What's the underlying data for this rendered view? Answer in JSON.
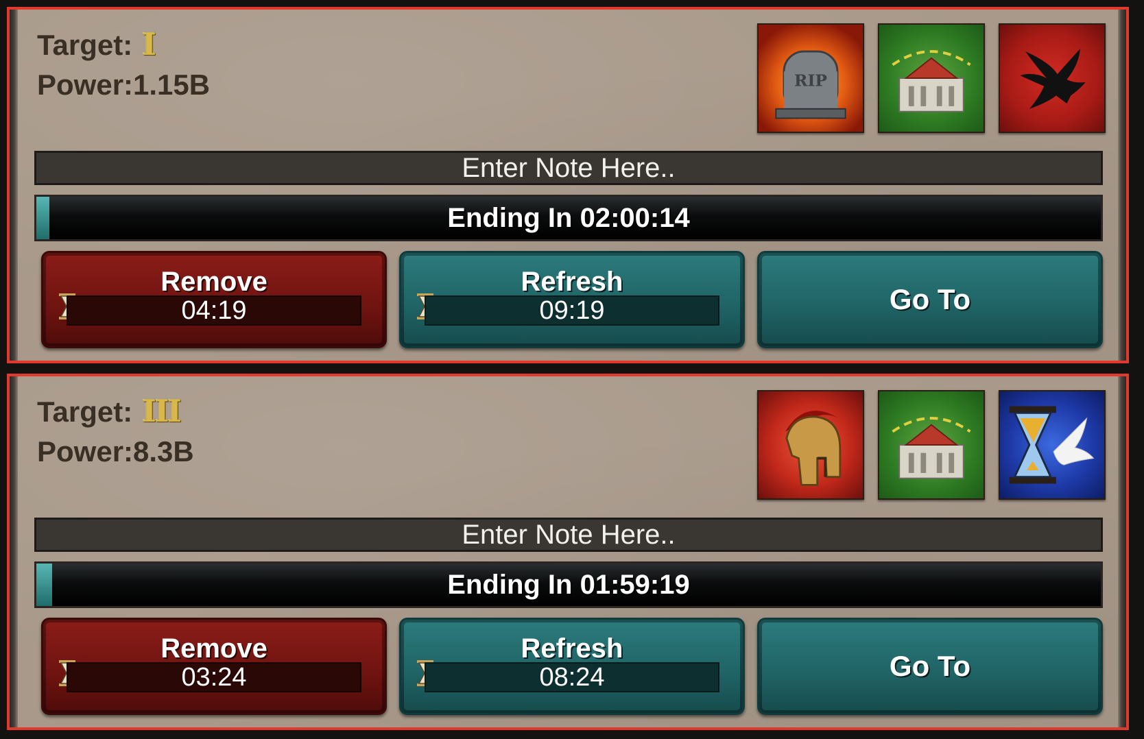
{
  "entries": [
    {
      "target_label": "Target:",
      "rank": "I",
      "power_label": "Power:1.15B",
      "icons": [
        "rip-tombstone-icon",
        "castle-icon",
        "eagle-icon"
      ],
      "note_placeholder": "Enter Note Here..",
      "ending_text": "Ending In 02:00:14",
      "progress": 0.01,
      "remove_label": "Remove",
      "remove_timer": "04:19",
      "refresh_label": "Refresh",
      "refresh_timer": "09:19",
      "goto_label": "Go To"
    },
    {
      "target_label": "Target:",
      "rank": "III",
      "power_label": "Power:8.3B",
      "icons": [
        "spartan-helmet-icon",
        "castle-icon",
        "hourglass-dove-icon"
      ],
      "note_placeholder": "Enter Note Here..",
      "ending_text": "Ending In 01:59:19",
      "progress": 0.015,
      "remove_label": "Remove",
      "remove_timer": "03:24",
      "refresh_label": "Refresh",
      "refresh_timer": "08:24",
      "goto_label": "Go To"
    }
  ],
  "colors": {
    "frame": "#e2392e",
    "remove": "#8b1d18",
    "teal": "#2c7b7d",
    "parchment": "#a8998a"
  }
}
